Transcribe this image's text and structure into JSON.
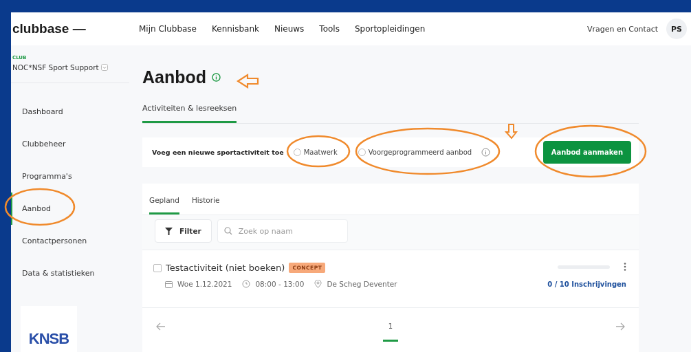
{
  "brand": {
    "logo": "clubbase —"
  },
  "nav": [
    {
      "label": "Mijn Clubbase"
    },
    {
      "label": "Kennisbank"
    },
    {
      "label": "Nieuws"
    },
    {
      "label": "Tools"
    },
    {
      "label": "Sportopleidingen"
    }
  ],
  "help_link": "Vragen en Contact",
  "avatar": "PS",
  "club": {
    "label": "CLUB",
    "name": "NOC*NSF Sport Support"
  },
  "sidebar": {
    "items": [
      {
        "label": "Dashboard",
        "selected": false
      },
      {
        "label": "Clubbeheer",
        "selected": false
      },
      {
        "label": "Programma's",
        "selected": false
      },
      {
        "label": "Aanbod",
        "selected": true
      },
      {
        "label": "Contactpersonen",
        "selected": false
      },
      {
        "label": "Data & statistieken",
        "selected": false
      }
    ]
  },
  "partner_logo": {
    "text": "KNSB"
  },
  "page": {
    "title": "Aanbod",
    "tabs": [
      {
        "label": "Activiteiten & lesreeksen",
        "selected": true
      }
    ],
    "add_bar": {
      "label": "Voeg een nieuwe sportactiviteit toe",
      "options": [
        {
          "label": "Maatwerk",
          "selected": false
        },
        {
          "label": "Voorgeprogrammeerd aanbod",
          "selected": false
        }
      ],
      "button": "Aanbod aanmaken"
    },
    "list": {
      "tabs": [
        {
          "label": "Gepland",
          "selected": true
        },
        {
          "label": "Historie",
          "selected": false
        }
      ],
      "filter_button": "Filter",
      "search": {
        "placeholder": "Zoek op naam"
      },
      "activities": [
        {
          "checked": false,
          "title": "Testactiviteit (niet boeken)",
          "badge": "CONCEPT",
          "date": "Woe 1.12.2021",
          "time": "08:00 - 13:00",
          "location": "De Scheg Deventer",
          "level": 0,
          "registrations": "0 / 10 Inschrijvingen"
        }
      ],
      "pagination": {
        "pages": [
          {
            "label": "1",
            "selected": true
          }
        ]
      }
    }
  }
}
